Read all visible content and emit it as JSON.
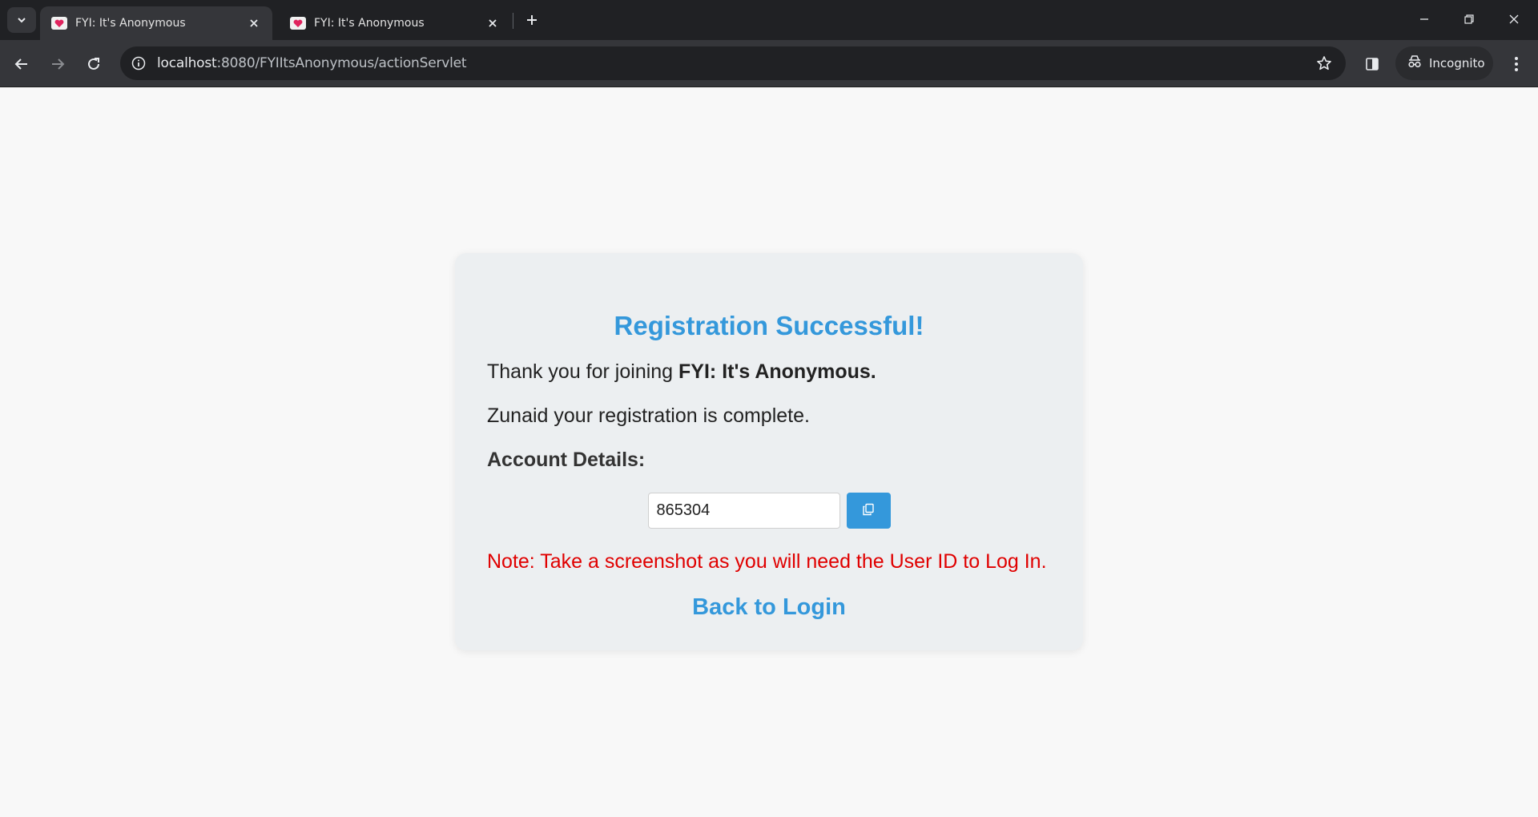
{
  "browser": {
    "tabs": [
      {
        "title": "FYI: It's Anonymous",
        "active": true
      },
      {
        "title": "FYI: It's Anonymous",
        "active": false
      }
    ],
    "url_host": "localhost",
    "url_path": ":8080/FYIItsAnonymous/actionServlet",
    "incognito_label": "Incognito",
    "icons": [
      "tab-search-icon",
      "favicon-heart-icon",
      "close-icon",
      "plus-icon",
      "minimize-icon",
      "restore-icon",
      "window-close-icon",
      "back-arrow-icon",
      "forward-arrow-icon",
      "reload-icon",
      "info-icon",
      "star-icon",
      "side-panel-icon",
      "incognito-icon",
      "kebab-menu-icon"
    ]
  },
  "page": {
    "heading": "Registration Successful!",
    "thanks_prefix": "Thank you for joining ",
    "thanks_brand": "FYI: It's Anonymous.",
    "complete_message": "Zunaid your registration is complete.",
    "account_details_label": "Account Details:",
    "user_id_value": "865304",
    "copy_icon": "copy-icon",
    "note": "Note: Take a screenshot as you will need the User ID to Log In.",
    "back_link": "Back to Login"
  },
  "colors": {
    "accent": "#3498db",
    "note_red": "#e00000",
    "card_bg": "#eceff1"
  }
}
